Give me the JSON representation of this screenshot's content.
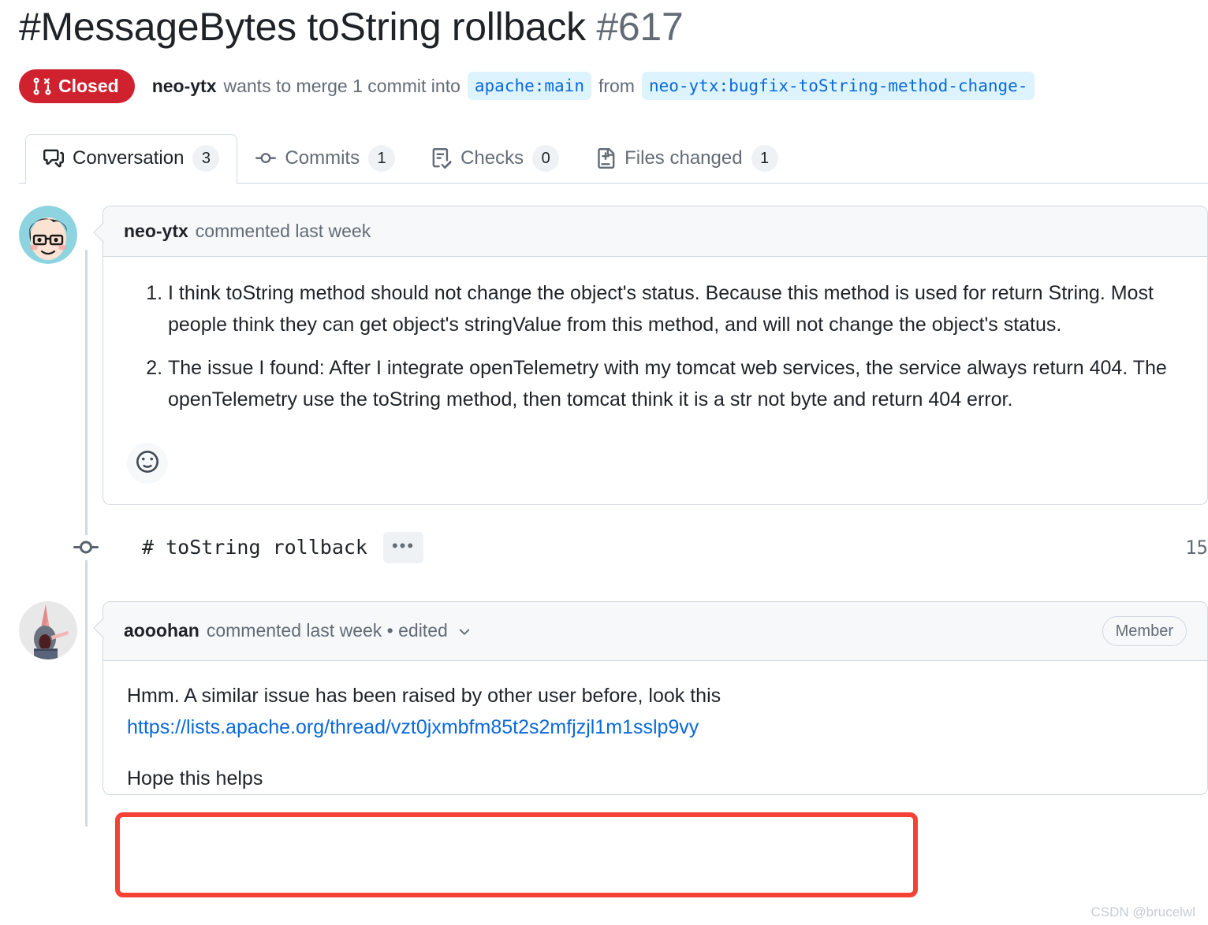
{
  "header": {
    "title": "#MessageBytes toString rollback",
    "number": "#617",
    "state": "Closed",
    "state_color": "#cf222e",
    "author": "neo-ytx",
    "merge_text_before": "wants to merge 1 commit into",
    "base_branch": "apache:main",
    "from_label": "from",
    "head_branch": "neo-ytx:bugfix-toString-method-change-"
  },
  "tabs": [
    {
      "label": "Conversation",
      "count": "3",
      "icon": "comment-discussion-icon",
      "selected": true
    },
    {
      "label": "Commits",
      "count": "1",
      "icon": "git-commit-icon",
      "selected": false
    },
    {
      "label": "Checks",
      "count": "0",
      "icon": "checklist-icon",
      "selected": false
    },
    {
      "label": "Files changed",
      "count": "1",
      "icon": "file-diff-icon",
      "selected": false
    }
  ],
  "comments": [
    {
      "author": "neo-ytx",
      "meta": "commented last week",
      "badge": "",
      "items": [
        "I think toString method should not change the object's status. Because this method is used for return String. Most people think they can get object's stringValue from this method, and will not change the object's status.",
        "The issue I found: After I integrate openTelemetry with my tomcat web services, the service always return 404. The openTelemetry use the toString method, then tomcat think it is a str not byte and return 404 error."
      ],
      "reaction_icon": "smiley-icon"
    },
    {
      "author": "aooohan",
      "meta": "commented last week • edited",
      "badge": "Member",
      "text_line1": "Hmm. A similar issue has been raised by other user before, look this",
      "link_text": "https://lists.apache.org/thread/vzt0jxmbfm85t2s2mfjzjl1m1sslp9vy",
      "link_color": "#0969da",
      "text_line2": "Hope this helps",
      "highlight_color": "#f44336"
    }
  ],
  "commit_row": {
    "message": "# toString rollback",
    "ellipsis": "•••",
    "sha": "15"
  },
  "watermark": "CSDN @brucelwl"
}
